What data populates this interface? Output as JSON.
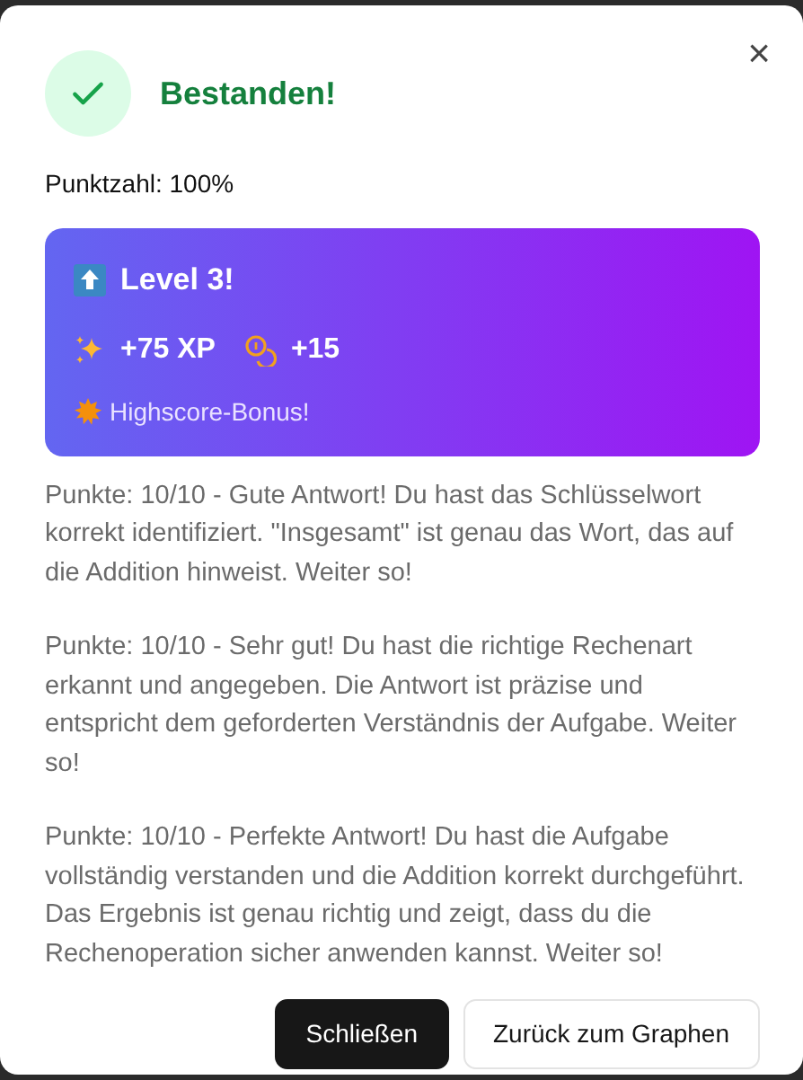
{
  "dialog": {
    "close_label": "×",
    "passed": true,
    "title": "Bestanden!",
    "score": "Punktzahl: 100%"
  },
  "reward_card": {
    "level": "Level 3!",
    "rewards": [
      {
        "kind": "xp",
        "text": "+75 XP"
      },
      {
        "kind": "coins",
        "text": "+15"
      }
    ],
    "bonus": "Highscore-Bonus!"
  },
  "feedback": [
    "Punkte: 10/10 - Gute Antwort! Du hast das Schlüsselwort korrekt identifiziert. \"Insgesamt\" ist genau das Wort, das auf die Addition hinweist. Weiter so!",
    "Punkte: 10/10 - Sehr gut! Du hast die richtige Rechenart erkannt und angegeben. Die Antwort ist präzise und entspricht dem geforderten Verständnis der Aufgabe. Weiter so!",
    "Punkte: 10/10 - Perfekte Antwort! Du hast die Aufgabe vollständig verstanden und die Addition korrekt durchgeführt. Das Ergebnis ist genau richtig und zeigt, dass du die Rechenoperation sicher anwenden kannst. Weiter so!"
  ],
  "buttons": [
    {
      "kind": "primary",
      "label": "Schließen"
    },
    {
      "kind": "secondary",
      "label": "Zurück zum Graphen"
    }
  ]
}
